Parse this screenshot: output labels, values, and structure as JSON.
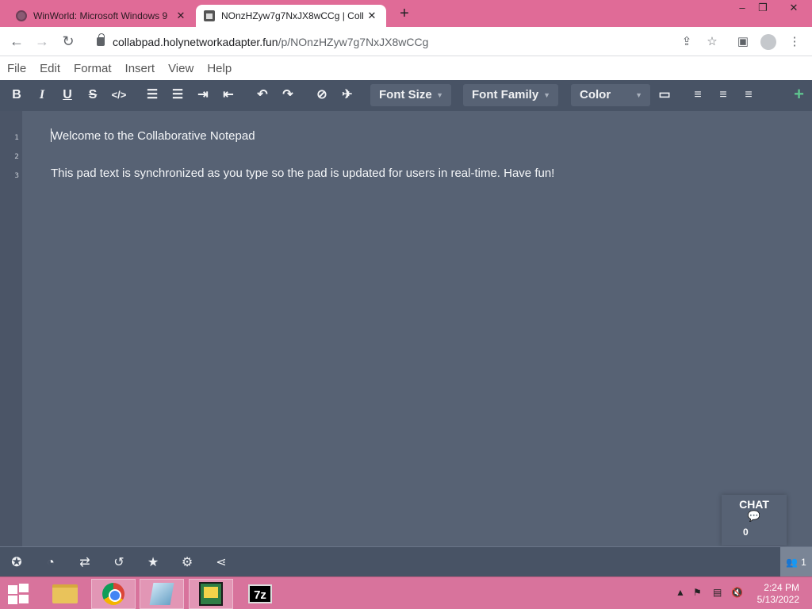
{
  "browser": {
    "tabs": [
      {
        "title": "WinWorld: Microsoft Windows 9",
        "close": "✕"
      },
      {
        "title": "NOnzHZyw7g7NxJX8wCCg | Coll",
        "close": "✕"
      }
    ],
    "new_tab": "+",
    "window_controls": {
      "minimize": "–",
      "restore": "❐",
      "close": "✕"
    },
    "url_host": "collabpad.holynetworkadapter.fun",
    "url_path": "/p/NOnzHZyw7g7NxJX8wCCg"
  },
  "menu": [
    "File",
    "Edit",
    "Format",
    "Insert",
    "View",
    "Help"
  ],
  "toolbar": {
    "bold": "B",
    "italic": "I",
    "underline": "U",
    "strike": "S",
    "code": "</>",
    "font_size": "Font Size",
    "font_family": "Font Family",
    "color": "Color",
    "plus": "+"
  },
  "editor": {
    "lines": [
      {
        "number": "1",
        "text": "Welcome to the Collaborative Notepad"
      },
      {
        "number": "2",
        "text": ""
      },
      {
        "number": "3",
        "text": "This pad text is synchronized as you type so the pad is updated for users in real-time. Have fun!"
      }
    ]
  },
  "chat": {
    "label": "CHAT",
    "count": "0"
  },
  "users": {
    "count": "1"
  },
  "taskbar": {
    "time": "2:24 PM",
    "date": "5/13/2022",
    "sevenzip": "7z"
  },
  "colors": {
    "tabbar": "#e06b97",
    "toolbar": "#485365",
    "editor": "#576274",
    "accent_plus": "#5ec48f",
    "taskbar": "#d8739c"
  }
}
